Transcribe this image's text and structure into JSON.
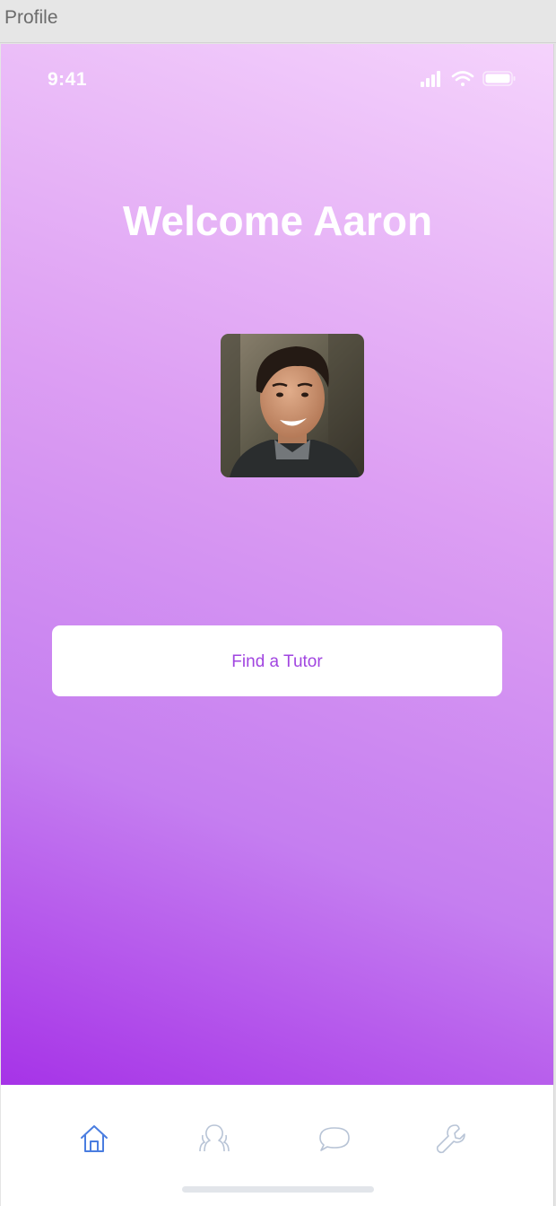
{
  "window": {
    "title": "Profile"
  },
  "status_bar": {
    "time": "9:41"
  },
  "profile": {
    "welcome": "Welcome Aaron"
  },
  "actions": {
    "find_tutor": "Find a Tutor"
  },
  "tab_bar": {
    "items": [
      {
        "icon": "home-icon",
        "active": true
      },
      {
        "icon": "users-icon",
        "active": false
      },
      {
        "icon": "chat-bubble-icon",
        "active": false
      },
      {
        "icon": "wrench-icon",
        "active": false
      }
    ]
  },
  "colors": {
    "gradient_top": "#f5d3fc",
    "gradient_bottom": "#a633e7",
    "button_text": "#a145e0",
    "tab_active": "#4a7de0",
    "tab_inactive": "#b8c4d6"
  }
}
